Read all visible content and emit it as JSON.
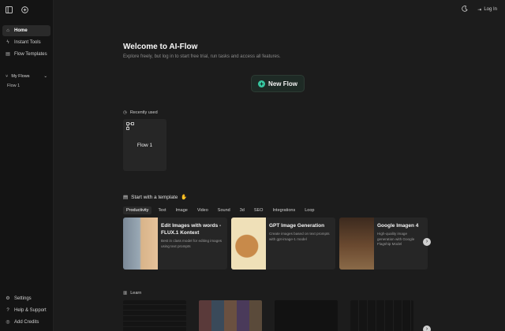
{
  "sidebar": {
    "nav": [
      {
        "label": "Home",
        "icon": "home-icon"
      },
      {
        "label": "Instant Tools",
        "icon": "bolt-icon"
      },
      {
        "label": "Flow Templates",
        "icon": "template-icon"
      }
    ],
    "flows_label": "My Flows",
    "flow_items": [
      "Flow 1"
    ],
    "bottom": [
      {
        "label": "Settings",
        "icon": "gear-icon"
      },
      {
        "label": "Help & Support",
        "icon": "help-icon"
      },
      {
        "label": "Add Credits",
        "icon": "credits-icon"
      }
    ]
  },
  "header": {
    "login": "Log In"
  },
  "main": {
    "title": "Welcome to AI-Flow",
    "subtitle": "Explore freely, but log in to start free trial, run tasks and access all features.",
    "new_flow": "New Flow",
    "recent_label": "Recently used",
    "recent_card": "Flow 1",
    "templates_label": "Start with a template",
    "tabs": [
      "Productivity",
      "Text",
      "Image",
      "Video",
      "Sound",
      "3d",
      "SEO",
      "Integrations",
      "Loop"
    ],
    "templates": [
      {
        "title": "Edit Images with words - FLUX.1 Kontext",
        "desc": "Best in class model for editing images using text prompts"
      },
      {
        "title": "GPT Image Generation",
        "desc": "Create images based on text prompts with gpt-image-1 model"
      },
      {
        "title": "Google Imagen 4",
        "desc": "High-quality image generation with Google Flagship Model"
      }
    ],
    "learn_label": "Learn"
  },
  "colors": {
    "accent": "#37c7a0",
    "background": "#1c1c1c",
    "sidebar": "#141414"
  }
}
